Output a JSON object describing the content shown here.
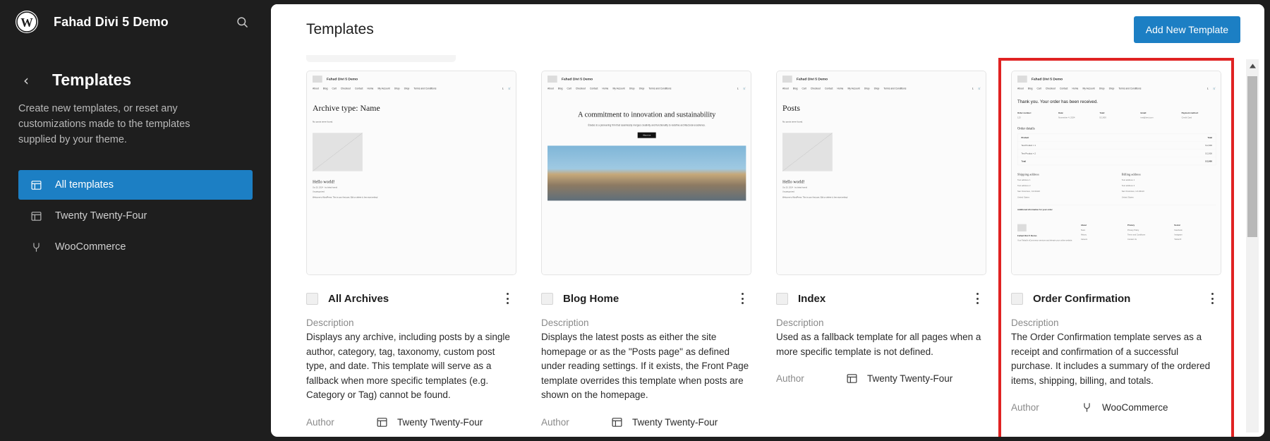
{
  "sidebar": {
    "site_name": "Fahad Divi 5 Demo",
    "search_icon": "search-icon",
    "wp_logo_glyph": "Ⓦ",
    "back_glyph": "‹",
    "title": "Templates",
    "description": "Create new templates, or reset any customizations made to the templates supplied by your theme.",
    "items": [
      {
        "label": "All templates",
        "icon": "template-icon",
        "active": true
      },
      {
        "label": "Twenty Twenty-Four",
        "icon": "template-icon",
        "active": false
      },
      {
        "label": "WooCommerce",
        "icon": "plugin-plug-icon",
        "active": false
      }
    ]
  },
  "header": {
    "title": "Templates",
    "add_button": "Add New Template",
    "accent_color": "#1c7fc4"
  },
  "highlight": {
    "color": "#e02222",
    "card_index": 3
  },
  "labels": {
    "description": "Description",
    "author": "Author"
  },
  "scrollbar": {
    "up_arrow": "▲"
  },
  "preview_common": {
    "site_name": "Fahad Divi 5 Demo",
    "nav": [
      "About",
      "Blog",
      "Cart",
      "Checkout",
      "Contact",
      "Home",
      "My Account",
      "Shop",
      "Shop",
      "Terms and Conditions"
    ],
    "account_icon": "account-icon",
    "cart_icon": "cart-icon"
  },
  "cards": [
    {
      "title": "All Archives",
      "description": "Displays any archive, including posts by a single author, category, tag, taxonomy, custom post type, and date. This template will serve as a fallback when more specific templates (e.g. Category or Tag) cannot be found.",
      "author": "Twenty Twenty-Four",
      "author_icon": "template-icon",
      "preview": {
        "kind": "archive",
        "heading": "Archive type: Name",
        "note": "No posts were found.",
        "post_title": "Hello world!",
        "post_meta": "Oct 20, 2024  ·  by fahad hamid",
        "post_cat": "Uncategorized",
        "post_body": "Welcome to WordPress. This is your first post. Edit or delete it, then start writing!"
      }
    },
    {
      "title": "Blog Home",
      "description": "Displays the latest posts as either the site homepage or as the \"Posts page\" as defined under reading settings. If it exists, the Front Page template overrides this template when posts are shown on the homepage.",
      "author": "Twenty Twenty-Four",
      "author_icon": "template-icon",
      "preview": {
        "kind": "hero",
        "heading": "A commitment to innovation and sustainability",
        "subtext": "Études is a pioneering firm that seamlessly merges creativity and functionality to redefine architectural excellence.",
        "button": "About us"
      }
    },
    {
      "title": "Index",
      "description": "Used as a fallback template for all pages when a more specific template is not defined.",
      "author": "Twenty Twenty-Four",
      "author_icon": "template-icon",
      "preview": {
        "kind": "posts",
        "heading": "Posts",
        "note": "No posts were found.",
        "post_title": "Hello world!",
        "post_meta": "Oct 20, 2024  ·  by fahad hamid",
        "post_cat": "Uncategorized",
        "post_body": "Welcome to WordPress. This is your first post. Edit or delete it, then start writing!"
      }
    },
    {
      "title": "Order Confirmation",
      "description": "The Order Confirmation template serves as a receipt and confirmation of a successful purchase. It includes a summary of the ordered items, shipping, billing, and totals.",
      "author": "WooCommerce",
      "author_icon": "plugin-plug-icon",
      "preview": {
        "kind": "order",
        "heading": "Thank you. Your order has been received.",
        "summary": [
          {
            "key": "Order number:",
            "value": "123"
          },
          {
            "key": "Date:",
            "value": "November 4, 2024"
          },
          {
            "key": "Total:",
            "value": "$ 2,000"
          },
          {
            "key": "Email:",
            "value": "test@test.com"
          },
          {
            "key": "Payment method:",
            "value": "Credit Card"
          }
        ],
        "details_title": "Order details",
        "table_head": {
          "product": "Product",
          "total": "Total"
        },
        "table_rows": [
          {
            "product": "Test Product × 1",
            "total": "$ 2,000"
          },
          {
            "product": "Test Product × 2",
            "total": "$ 2,000"
          }
        ],
        "total_row": {
          "product": "Total",
          "total": "$ 2,000"
        },
        "shipping_title": "Shipping address",
        "billing_title": "Billing address",
        "address_lines": [
          "Test address 1",
          "Test address 2",
          "San Francisco, CA 94110",
          "United States"
        ],
        "note": "Additional information for your order",
        "footer_name": "Fahad Divi 5 Demo",
        "footer_desc": "Your Fahad's eCommerce services and elevate your online website.",
        "footer_cols": [
          {
            "head": "About",
            "items": [
              "Team",
              "History",
              "Careers"
            ]
          },
          {
            "head": "Privacy",
            "items": [
              "Privacy Policy",
              "Terms and Conditions",
              "Contact Us"
            ]
          },
          {
            "head": "Social",
            "items": [
              "Facebook",
              "Instagram",
              "Twitter/X"
            ]
          }
        ]
      }
    }
  ]
}
